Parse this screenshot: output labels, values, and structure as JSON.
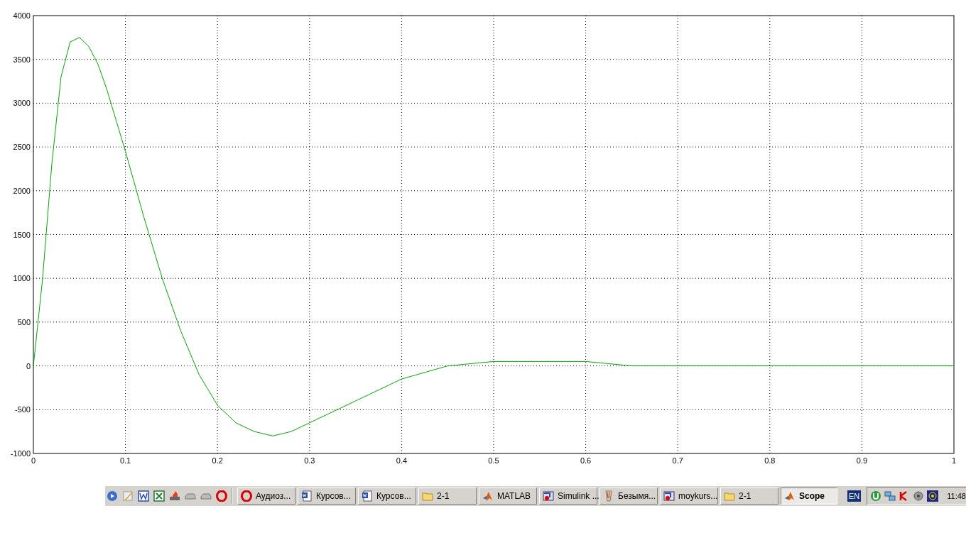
{
  "plot": {
    "chart_data": {
      "type": "line",
      "x": [
        0,
        0.01,
        0.02,
        0.03,
        0.04,
        0.05,
        0.06,
        0.07,
        0.08,
        0.09,
        0.1,
        0.12,
        0.14,
        0.16,
        0.18,
        0.2,
        0.22,
        0.24,
        0.26,
        0.28,
        0.3,
        0.32,
        0.35,
        0.4,
        0.45,
        0.5,
        0.55,
        0.6,
        0.65,
        0.7,
        0.75,
        0.8,
        0.85,
        0.9,
        0.95,
        1
      ],
      "grid": true,
      "series": [
        {
          "color": "#00aa00",
          "values": [
            0,
            1000,
            2300,
            3300,
            3700,
            3750,
            3650,
            3450,
            3150,
            2800,
            2450,
            1700,
            1000,
            400,
            -100,
            -450,
            -650,
            -750,
            -800,
            -750,
            -650,
            -550,
            -400,
            -150,
            0,
            50,
            50,
            50,
            0,
            0,
            0,
            0,
            0,
            0,
            0,
            0
          ]
        }
      ],
      "xlim": [
        0,
        1
      ],
      "ylim": [
        -1000,
        4000
      ],
      "xticks": [
        {
          "value": 0,
          "label": "0"
        },
        {
          "value": 0.1,
          "label": "0.1"
        },
        {
          "value": 0.2,
          "label": "0.2"
        },
        {
          "value": 0.3,
          "label": "0.3"
        },
        {
          "value": 0.4,
          "label": "0.4"
        },
        {
          "value": 0.5,
          "label": "0.5"
        },
        {
          "value": 0.6,
          "label": "0.6"
        },
        {
          "value": 0.7,
          "label": "0.7"
        },
        {
          "value": 0.8,
          "label": "0.8"
        },
        {
          "value": 0.9,
          "label": "0.9"
        },
        {
          "value": 1,
          "label": "1"
        }
      ],
      "yticks": [
        {
          "value": -1000,
          "label": "-1000"
        },
        {
          "value": -500,
          "label": "-500"
        },
        {
          "value": 0,
          "label": "0"
        },
        {
          "value": 500,
          "label": "500"
        },
        {
          "value": 1000,
          "label": "1000"
        },
        {
          "value": 1500,
          "label": "1500"
        },
        {
          "value": 2000,
          "label": "2000"
        },
        {
          "value": 2500,
          "label": "2500"
        },
        {
          "value": 3000,
          "label": "3000"
        },
        {
          "value": 3500,
          "label": "3500"
        },
        {
          "value": 4000,
          "label": "4000"
        }
      ]
    }
  },
  "taskbar": {
    "buttons": [
      {
        "kind": "opera",
        "label": "Аудиоз...",
        "selected": false
      },
      {
        "kind": "document",
        "label": "Курсов...",
        "selected": false
      },
      {
        "kind": "document",
        "label": "Курсов...",
        "selected": false
      },
      {
        "kind": "folder",
        "label": "2-1",
        "selected": false
      },
      {
        "kind": "matlab",
        "label": "MATLAB",
        "selected": false
      },
      {
        "kind": "model",
        "label": "Simulink ...",
        "selected": false
      },
      {
        "kind": "paint",
        "label": "Безымя...",
        "selected": false
      },
      {
        "kind": "model",
        "label": "moykurs...",
        "selected": false
      },
      {
        "kind": "folder",
        "label": "2-1",
        "selected": false
      },
      {
        "kind": "matlab",
        "label": "Scope",
        "selected": true
      }
    ],
    "language": "EN",
    "clock": "11:48"
  }
}
